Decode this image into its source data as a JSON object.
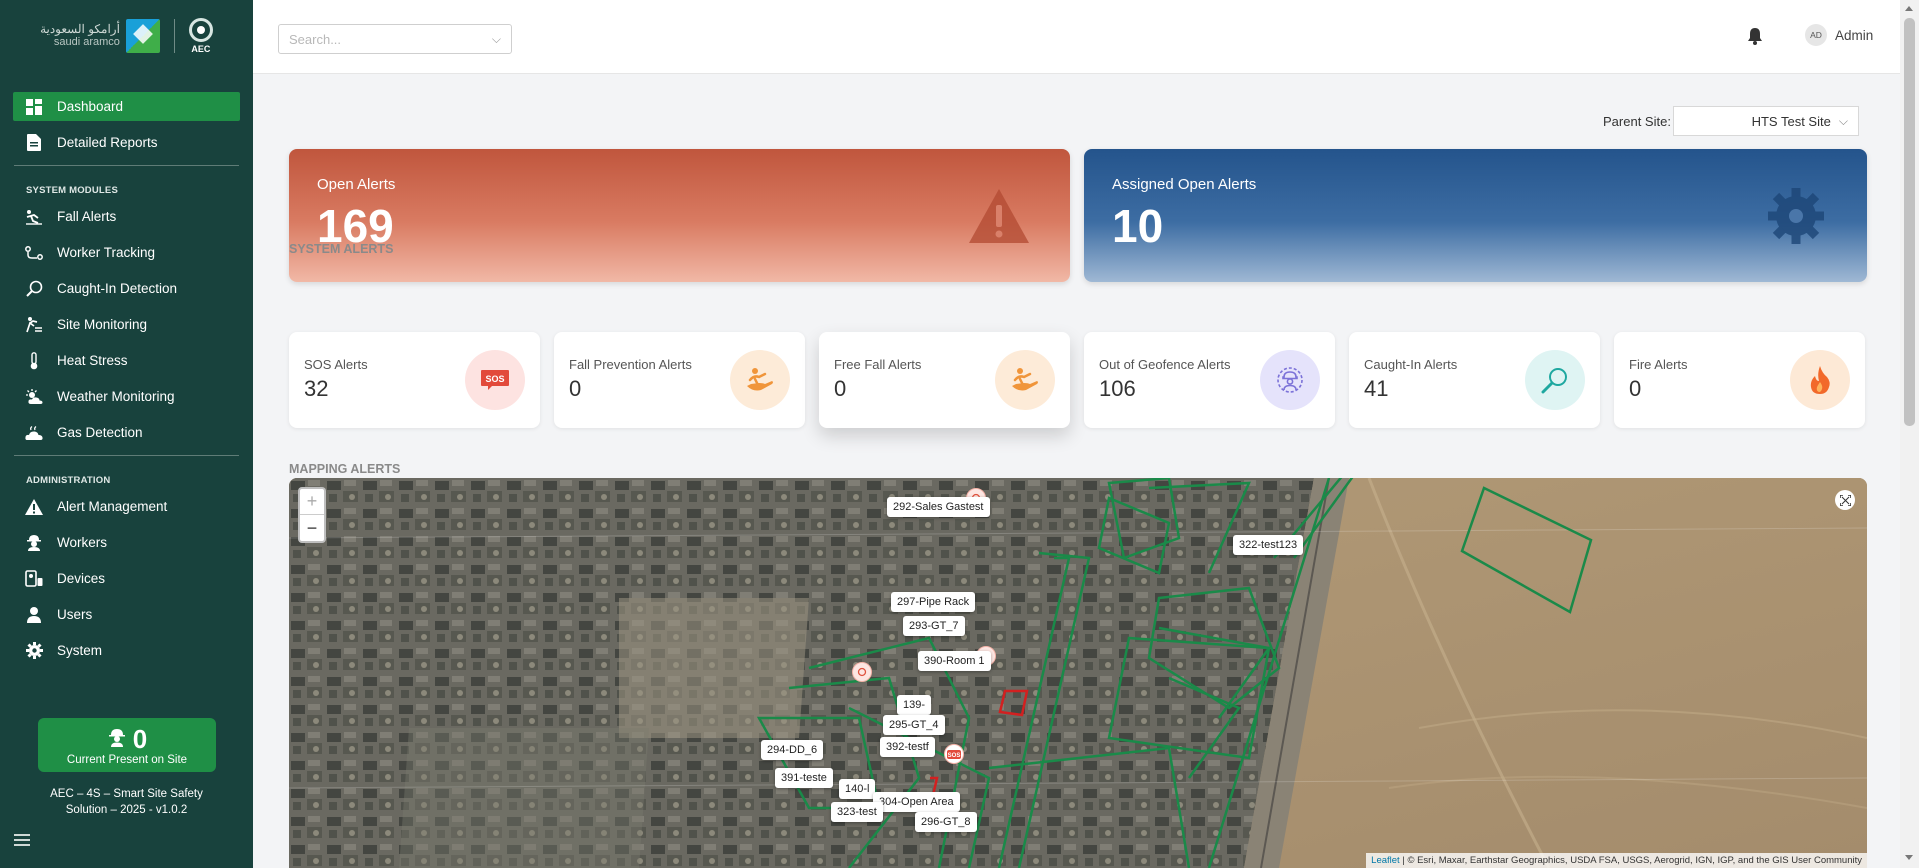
{
  "brand": {
    "arabic_name": "أرامكو السعودية",
    "latin_name": "saudi aramco",
    "partner": "AEC"
  },
  "sidebar": {
    "main_items": [
      {
        "label": "Dashboard",
        "icon": "dashboard-icon",
        "active": true
      },
      {
        "label": "Detailed Reports",
        "icon": "report-icon",
        "active": false
      }
    ],
    "modules_title": "SYSTEM MODULES",
    "modules": [
      {
        "label": "Fall Alerts",
        "icon": "fall-icon"
      },
      {
        "label": "Worker Tracking",
        "icon": "route-icon"
      },
      {
        "label": "Caught-In Detection",
        "icon": "magnifier-icon"
      },
      {
        "label": "Site Monitoring",
        "icon": "site-icon"
      },
      {
        "label": "Heat Stress",
        "icon": "thermometer-icon"
      },
      {
        "label": "Weather Monitoring",
        "icon": "weather-icon"
      },
      {
        "label": "Gas Detection",
        "icon": "gas-icon"
      }
    ],
    "admin_title": "ADMINISTRATION",
    "admin": [
      {
        "label": "Alert Management",
        "icon": "warning-icon"
      },
      {
        "label": "Workers",
        "icon": "worker-icon"
      },
      {
        "label": "Devices",
        "icon": "device-icon"
      },
      {
        "label": "Users",
        "icon": "user-icon"
      },
      {
        "label": "System",
        "icon": "gear-icon"
      }
    ],
    "present": {
      "count": "0",
      "label": "Current Present on Site"
    },
    "version_line1": "AEC – 4S – Smart Site Safety",
    "version_line2": "Solution – 2025 - v1.0.2"
  },
  "topbar": {
    "search_placeholder": "Search...",
    "user_initials": "AD",
    "user_name": "Admin"
  },
  "filters": {
    "parent_site_label": "Parent Site:",
    "parent_site_value": "HTS Test Site"
  },
  "summary": {
    "open_alerts": {
      "title": "Open Alerts",
      "value": "169"
    },
    "assigned_open_alerts": {
      "title": "Assigned Open Alerts",
      "value": "10"
    }
  },
  "system_alerts_title": "SYSTEM ALERTS",
  "system_alerts": [
    {
      "title": "SOS Alerts",
      "value": "32",
      "icon": "sos-icon",
      "color": "#fde3e1"
    },
    {
      "title": "Fall Prevention Alerts",
      "value": "0",
      "icon": "fall-hand-icon",
      "color": "#fdebd8"
    },
    {
      "title": "Free Fall Alerts",
      "value": "0",
      "icon": "fall-hand-icon",
      "color": "#fdebd8"
    },
    {
      "title": "Out of Geofence Alerts",
      "value": "106",
      "icon": "geofence-worker-icon",
      "color": "#e5e3fb"
    },
    {
      "title": "Caught-In Alerts",
      "value": "41",
      "icon": "magnifier-icon",
      "color": "#dff4f3"
    },
    {
      "title": "Fire Alerts",
      "value": "0",
      "icon": "fire-icon",
      "color": "#fde9d6"
    }
  ],
  "mapping_title": "MAPPING ALERTS",
  "map": {
    "zoom_in": "+",
    "zoom_out": "−",
    "labels": [
      "292-Sales Gastest",
      "322-test123",
      "297-Pipe Rack",
      "293-GT_7",
      "390-Room 1",
      "139-",
      "295-GT_4",
      "392-testf",
      "294-DD_6",
      "391-teste",
      "140-l",
      "304-Open Area",
      "323-test",
      "296-GT_8"
    ],
    "attribution_link": "Leaflet",
    "attribution_text": "| © Esri, Maxar, Earthstar Geographics, USDA FSA, USGS, Aerogrid, IGN, IGP, and the GIS User Community"
  },
  "colors": {
    "sidebar_bg": "#18423d",
    "accent_green": "#1f8f46",
    "open_alert": "#c0563d",
    "assigned_alert": "#24548c"
  }
}
